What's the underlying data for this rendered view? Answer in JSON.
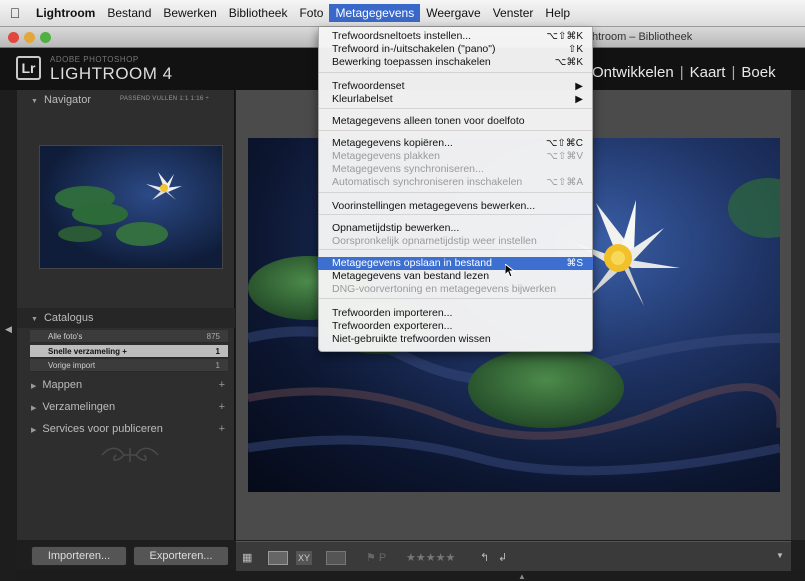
{
  "menubar": {
    "items": [
      "Lightroom",
      "Bestand",
      "Bewerken",
      "Bibliotheek",
      "Foto",
      "Metagegevens",
      "Weergave",
      "Venster",
      "Help"
    ],
    "active": "Metagegevens"
  },
  "window": {
    "title": "htroom – Bibliotheek"
  },
  "identity": {
    "adobe": "ADOBE PHOTOSHOP",
    "product": "LIGHTROOM 4",
    "logo": "Lr"
  },
  "modules": [
    "Ontwikkelen",
    "Kaart",
    "Boek"
  ],
  "navigator": {
    "title": "Navigator",
    "options": "PASSEND   VULLEN   1:1   1:16 ÷"
  },
  "catalogus": {
    "title": "Catalogus",
    "rows": [
      {
        "label": "Alle foto's",
        "count": "875"
      },
      {
        "label": "Snelle verzameling +",
        "count": "1"
      },
      {
        "label": "Vorige import",
        "count": "1"
      }
    ]
  },
  "panels": {
    "mappen": "Mappen",
    "verzamelingen": "Verzamelingen",
    "services": "Services voor publiceren"
  },
  "buttons": {
    "import": "Importeren...",
    "export": "Exporteren..."
  },
  "menu": {
    "items": [
      {
        "label": "Trefwoordsneltoets instellen...",
        "shortcut": "⌥⇧⌘K",
        "state": "enabled"
      },
      {
        "label": "Trefwoord in-/uitschakelen (\"pano\")",
        "shortcut": "⇧K",
        "state": "enabled"
      },
      {
        "label": "Bewerking toepassen inschakelen",
        "shortcut": "⌥⌘K",
        "state": "enabled"
      },
      {
        "label": "Trefwoordenset",
        "shortcut": "▶",
        "state": "enabled"
      },
      {
        "label": "Kleurlabelset",
        "shortcut": "▶",
        "state": "enabled"
      },
      {
        "label": "Metagegevens alleen tonen voor doelfoto",
        "shortcut": "",
        "state": "enabled"
      },
      {
        "label": "Metagegevens kopiëren...",
        "shortcut": "⌥⇧⌘C",
        "state": "enabled"
      },
      {
        "label": "Metagegevens plakken",
        "shortcut": "⌥⇧⌘V",
        "state": "disabled"
      },
      {
        "label": "Metagegevens synchroniseren...",
        "shortcut": "",
        "state": "disabled"
      },
      {
        "label": "Automatisch synchroniseren inschakelen",
        "shortcut": "⌥⇧⌘A",
        "state": "disabled"
      },
      {
        "label": "Voorinstellingen metagegevens bewerken...",
        "shortcut": "",
        "state": "enabled"
      },
      {
        "label": "Opnametijdstip bewerken...",
        "shortcut": "",
        "state": "enabled"
      },
      {
        "label": "Oorspronkelijk opnametijdstip weer instellen",
        "shortcut": "",
        "state": "disabled"
      },
      {
        "label": "Metagegevens opslaan in bestand",
        "shortcut": "⌘S",
        "state": "highlighted"
      },
      {
        "label": "Metagegevens van bestand lezen",
        "shortcut": "",
        "state": "enabled"
      },
      {
        "label": "DNG-voorvertoning en metagegevens bijwerken",
        "shortcut": "",
        "state": "disabled"
      },
      {
        "label": "Trefwoorden importeren...",
        "shortcut": "",
        "state": "enabled"
      },
      {
        "label": "Trefwoorden exporteren...",
        "shortcut": "",
        "state": "enabled"
      },
      {
        "label": "Niet-gebruikte trefwoorden wissen",
        "shortcut": "",
        "state": "enabled"
      }
    ]
  },
  "toolbar": {
    "rating_stars": "★★★★★"
  },
  "colors": {
    "menu_highlight": "#3d6fd1",
    "menubar_active": "#3a68c8"
  }
}
